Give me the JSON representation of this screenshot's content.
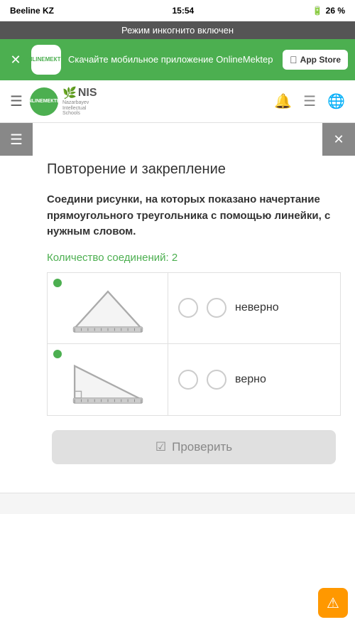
{
  "status_bar": {
    "carrier": "Beeline KZ",
    "wifi": "📶",
    "time": "15:54",
    "battery": "26 %"
  },
  "incognito": {
    "text": "Режим инкогнито включен"
  },
  "promo": {
    "text": "Скачайте мобильное приложение OnlineMektep",
    "logo_line1": "ONLINE",
    "logo_line2": "МЕКТЕП",
    "button_label": "App Store"
  },
  "nav": {
    "logo_line1": "ONLINE",
    "logo_line2": "МЕКТЕП",
    "nis_label": "NIS",
    "nis_subtitle": "Nazarbayev\nIntellectual\nSchools"
  },
  "page": {
    "title": "Повторение и закрепление",
    "task": "Соедини рисунки, на которых показано начертание прямоугольного треугольника с помощью линейки, с нужным словом.",
    "connections_label": "Количество соединений:",
    "connections_count": "2",
    "rows": [
      {
        "word": "неверно"
      },
      {
        "word": "верно"
      }
    ],
    "check_button": "Проверить"
  }
}
